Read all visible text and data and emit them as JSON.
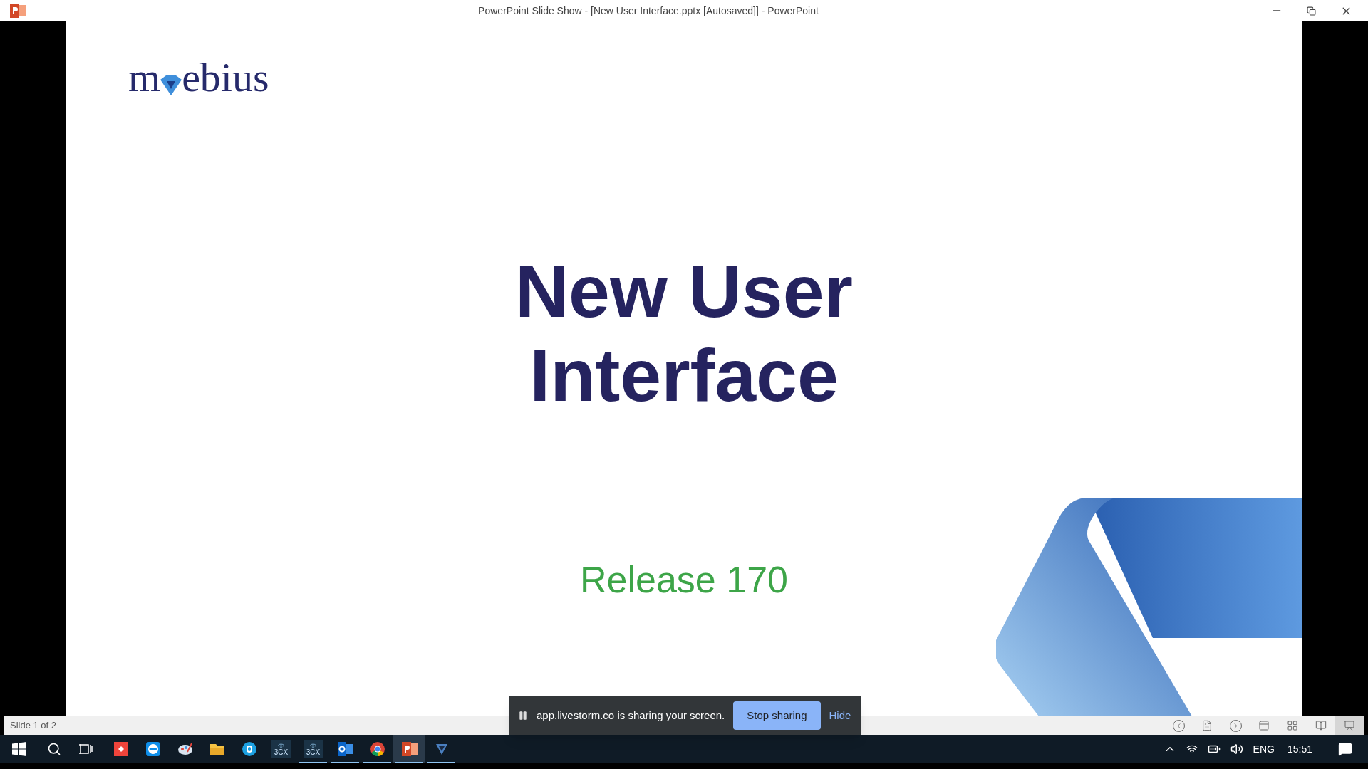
{
  "window": {
    "title": "PowerPoint Slide Show - [New User Interface.pptx [Autosaved]] - PowerPoint"
  },
  "slide": {
    "logo": {
      "before": "m",
      "after": "ebius"
    },
    "title_lines": [
      "New User",
      "Interface"
    ],
    "subtitle": "Release 170"
  },
  "sharing_bar": {
    "message": "app.livestorm.co is sharing your screen.",
    "stop_button": "Stop sharing",
    "hide_link": "Hide"
  },
  "status_bar": {
    "slide_counter": "Slide 1 of 2",
    "view_buttons": [
      {
        "kind": "previous",
        "selected": false
      },
      {
        "kind": "notes",
        "selected": false
      },
      {
        "kind": "next",
        "selected": false
      },
      {
        "kind": "normal",
        "selected": false
      },
      {
        "kind": "sorter",
        "selected": false
      },
      {
        "kind": "reading",
        "selected": false
      },
      {
        "kind": "slideshow",
        "selected": true
      }
    ]
  },
  "taskbar": {
    "apps": [
      {
        "kind": "anydesk",
        "running": false,
        "selected": false
      },
      {
        "kind": "teamviewer",
        "running": false,
        "selected": false
      },
      {
        "kind": "paint",
        "running": false,
        "selected": false
      },
      {
        "kind": "folder",
        "running": false,
        "selected": false
      },
      {
        "kind": "skype",
        "running": false,
        "selected": false
      },
      {
        "kind": "phone",
        "label": "3CX",
        "running": false,
        "selected": false
      },
      {
        "kind": "phone",
        "label": "3CX",
        "running": true,
        "selected": false
      },
      {
        "kind": "outlook",
        "running": true,
        "selected": false
      },
      {
        "kind": "chrome",
        "running": true,
        "selected": false
      },
      {
        "kind": "powerpoint",
        "running": true,
        "selected": true
      },
      {
        "kind": "shield",
        "running": true,
        "selected": false
      }
    ],
    "language": "ENG",
    "time": "15:51"
  }
}
